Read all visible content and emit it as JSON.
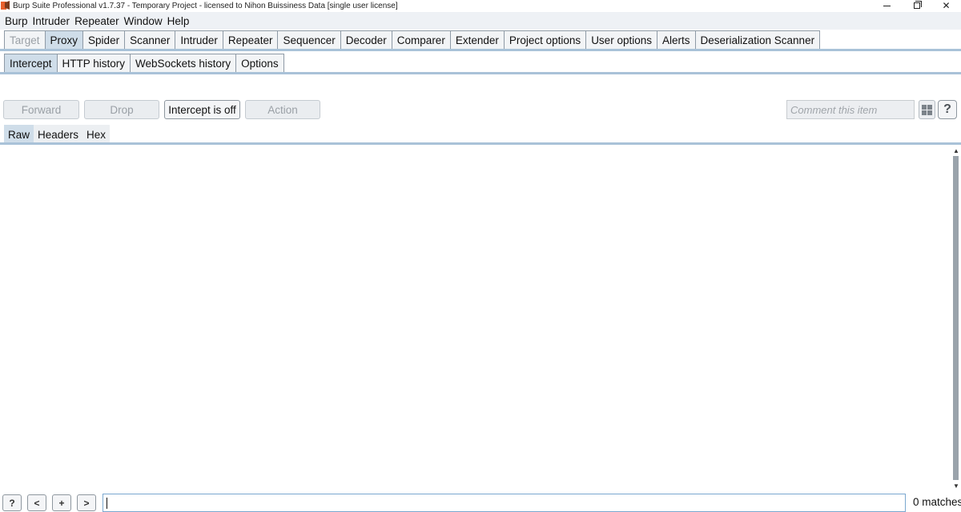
{
  "window": {
    "title": "Burp Suite Professional v1.7.37 - Temporary Project - licensed to Nihon Buissiness Data [single user license]",
    "minimize": "–",
    "close": "✕"
  },
  "menu": [
    "Burp",
    "Intruder",
    "Repeater",
    "Window",
    "Help"
  ],
  "main_tabs": [
    {
      "label": "Target",
      "state": "disabled"
    },
    {
      "label": "Proxy",
      "state": "active"
    },
    {
      "label": "Spider",
      "state": "normal"
    },
    {
      "label": "Scanner",
      "state": "normal"
    },
    {
      "label": "Intruder",
      "state": "normal"
    },
    {
      "label": "Repeater",
      "state": "normal"
    },
    {
      "label": "Sequencer",
      "state": "normal"
    },
    {
      "label": "Decoder",
      "state": "normal"
    },
    {
      "label": "Comparer",
      "state": "normal"
    },
    {
      "label": "Extender",
      "state": "normal"
    },
    {
      "label": "Project options",
      "state": "normal"
    },
    {
      "label": "User options",
      "state": "normal"
    },
    {
      "label": "Alerts",
      "state": "normal"
    },
    {
      "label": "Deserialization Scanner",
      "state": "normal"
    }
  ],
  "sub_tabs": [
    {
      "label": "Intercept",
      "state": "active"
    },
    {
      "label": "HTTP history",
      "state": "normal"
    },
    {
      "label": "WebSockets history",
      "state": "normal"
    },
    {
      "label": "Options",
      "state": "normal"
    }
  ],
  "toolbar": {
    "forward": "Forward",
    "drop": "Drop",
    "intercept": "Intercept is off",
    "action": "Action",
    "comment_placeholder": "Comment this item",
    "help": "?"
  },
  "editor_tabs": [
    {
      "label": "Raw",
      "state": "active"
    },
    {
      "label": "Headers",
      "state": "normal"
    },
    {
      "label": "Hex",
      "state": "normal"
    }
  ],
  "scrollbar": {
    "up": "▲",
    "down": "▼"
  },
  "bottom": {
    "help": "?",
    "prev": "<",
    "add": "+",
    "next": ">",
    "search_value": "",
    "matches": "0 matches"
  },
  "colors": {
    "accent": "#a9c2d8",
    "active_tab": "#cfdde9",
    "app_icon": "#e8602c"
  }
}
